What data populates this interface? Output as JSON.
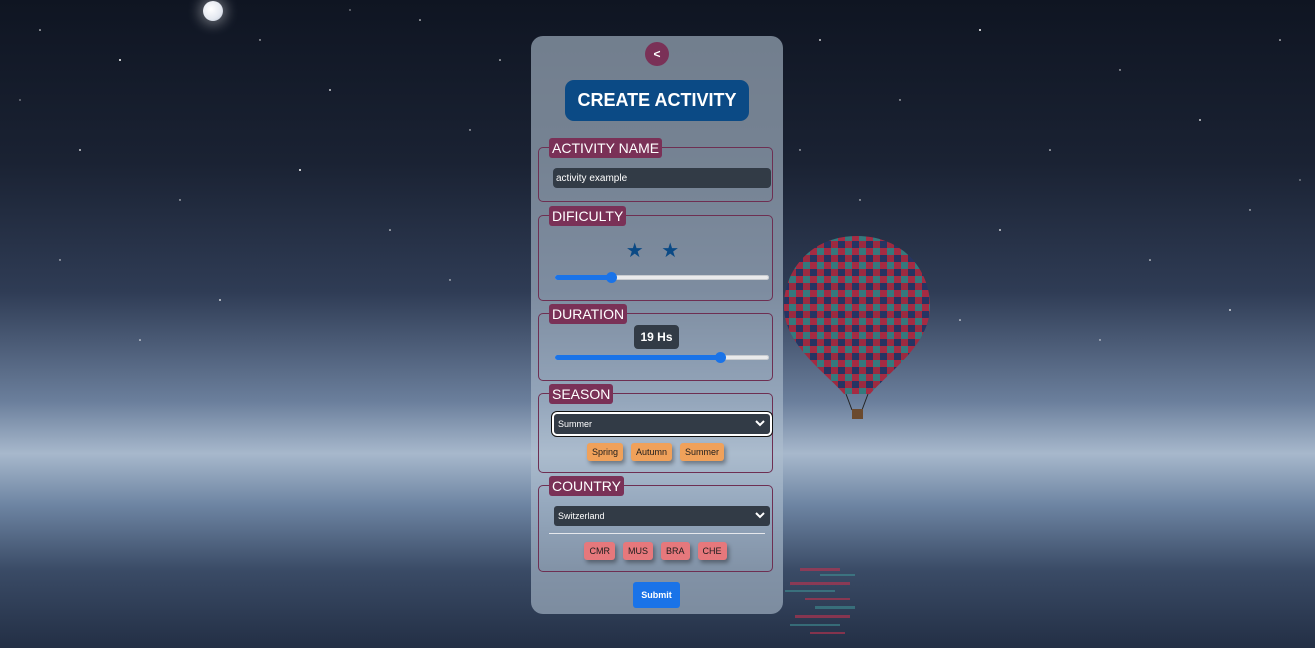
{
  "header": {
    "back_label": "<",
    "title": "CREATE ACTIVITY"
  },
  "activity_name": {
    "legend": "ACTIVITY NAME",
    "value": "activity example"
  },
  "difficulty": {
    "legend": "DIFICULTY",
    "stars": "★ ★",
    "level": 2,
    "slider_fraction": 0.26
  },
  "duration": {
    "legend": "DURATION",
    "value_label": "19 Hs",
    "hours": 19,
    "slider_fraction": 0.77
  },
  "season": {
    "legend": "SEASON",
    "selected": "Summer",
    "tags": [
      "Spring",
      "Autumn",
      "Summer"
    ]
  },
  "country": {
    "legend": "COUNTRY",
    "selected": "Switzerland",
    "tags": [
      "CMR",
      "MUS",
      "BRA",
      "CHE"
    ]
  },
  "submit_label": "Submit",
  "colors": {
    "accent": "#1a73e8",
    "legend_bg": "#7a3157",
    "title_bg": "#0b4a85",
    "season_tag": "#f0a15a",
    "country_tag": "#e6787c"
  },
  "icons": [
    "moon",
    "hot-air-balloon",
    "chevron-down-icon",
    "star-icon"
  ]
}
